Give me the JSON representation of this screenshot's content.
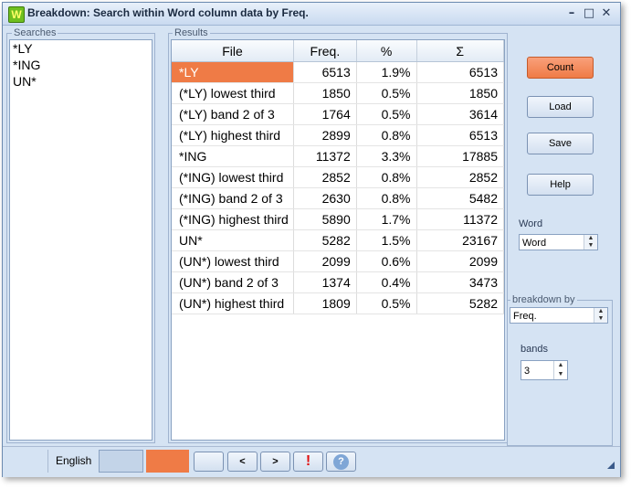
{
  "window": {
    "title": "Breakdown: Search within Word column data by Freq.",
    "app_icon_letter": "W",
    "controls": {
      "minimize": "–",
      "maximize": "□",
      "close": "✕"
    }
  },
  "searches": {
    "legend": "Searches",
    "items": [
      "*LY",
      "*ING",
      "UN*"
    ]
  },
  "results": {
    "legend": "Results",
    "columns": [
      "File",
      "Freq.",
      "%",
      "Σ"
    ],
    "rows": [
      {
        "file": "*LY",
        "freq": "6513",
        "pct": "1.9%",
        "sum": "6513",
        "selected": true
      },
      {
        "file": "(*LY) lowest third",
        "freq": "1850",
        "pct": "0.5%",
        "sum": "1850"
      },
      {
        "file": "(*LY) band 2 of 3",
        "freq": "1764",
        "pct": "0.5%",
        "sum": "3614"
      },
      {
        "file": "(*LY) highest third",
        "freq": "2899",
        "pct": "0.8%",
        "sum": "6513"
      },
      {
        "file": "*ING",
        "freq": "11372",
        "pct": "3.3%",
        "sum": "17885"
      },
      {
        "file": "(*ING) lowest third",
        "freq": "2852",
        "pct": "0.8%",
        "sum": "2852"
      },
      {
        "file": "(*ING) band 2 of 3",
        "freq": "2630",
        "pct": "0.8%",
        "sum": "5482"
      },
      {
        "file": "(*ING) highest third",
        "freq": "5890",
        "pct": "1.7%",
        "sum": "11372"
      },
      {
        "file": "UN*",
        "freq": "5282",
        "pct": "1.5%",
        "sum": "23167"
      },
      {
        "file": "(UN*) lowest third",
        "freq": "2099",
        "pct": "0.6%",
        "sum": "2099"
      },
      {
        "file": "(UN*) band 2 of 3",
        "freq": "1374",
        "pct": "0.4%",
        "sum": "3473"
      },
      {
        "file": "(UN*) highest third",
        "freq": "1809",
        "pct": "0.5%",
        "sum": "5282"
      }
    ]
  },
  "buttons": {
    "count": "Count",
    "load": "Load",
    "save": "Save",
    "help": "Help"
  },
  "word": {
    "label": "Word",
    "value": "Word"
  },
  "breakdown": {
    "legend": "breakdown by",
    "value": "Freq."
  },
  "bands": {
    "label": "bands",
    "value": "3"
  },
  "statusbar": {
    "language": "English",
    "prev": "<",
    "next": ">",
    "alert": "!",
    "help": "?"
  },
  "colors": {
    "accent": "#ef7b46",
    "window_bg": "#d5e3f3"
  }
}
